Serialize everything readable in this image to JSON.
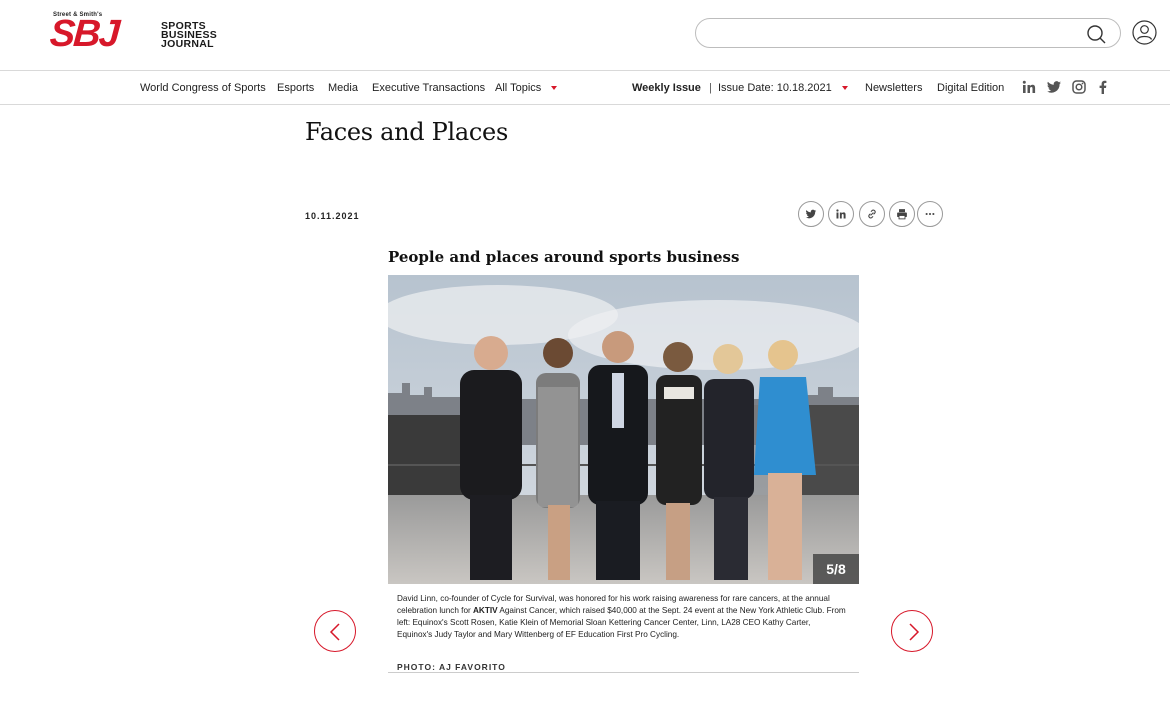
{
  "brand": {
    "tagline": "Street & Smith's",
    "abbr": "SBJ",
    "words": [
      "SPORTS",
      "BUSINESS",
      "JOURNAL"
    ],
    "accent": "#d7182a"
  },
  "search": {
    "placeholder": "",
    "value": ""
  },
  "nav": {
    "items": [
      "World Congress of Sports",
      "Esports",
      "Media",
      "Executive Transactions",
      "All Topics"
    ],
    "weekly_issue": "Weekly Issue",
    "separator": "|",
    "issue_date": "Issue Date: 10.18.2021",
    "newsletters": "Newsletters",
    "digital_edition": "Digital Edition",
    "social_icons": [
      "linkedin-icon",
      "twitter-icon",
      "instagram-icon",
      "facebook-icon"
    ]
  },
  "article": {
    "title": "Faces and Places",
    "date": "10.11.2021",
    "share_icons": [
      "twitter-icon",
      "linkedin-icon",
      "link-icon",
      "print-icon",
      "more-icon"
    ],
    "gallery_title": "People and places around sports business",
    "counter": "5/8",
    "caption_before": "David Linn, co-founder of Cycle for Survival, was honored for his work raising awareness for rare cancers, at the annual celebration lunch for ",
    "caption_bold": "AKTIV",
    "caption_after": " Against Cancer, which raised $40,000 at the Sept. 24 event at the New York Athletic Club. From left: Equinox's Scott Rosen, Katie Klein of Memorial Sloan Kettering Cancer Center, Linn, LA28 CEO Kathy Carter, Equinox's Judy Taylor and Mary Wittenberg of EF Education First Pro Cycling.",
    "credit": "PHOTO: AJ FAVORITO"
  }
}
